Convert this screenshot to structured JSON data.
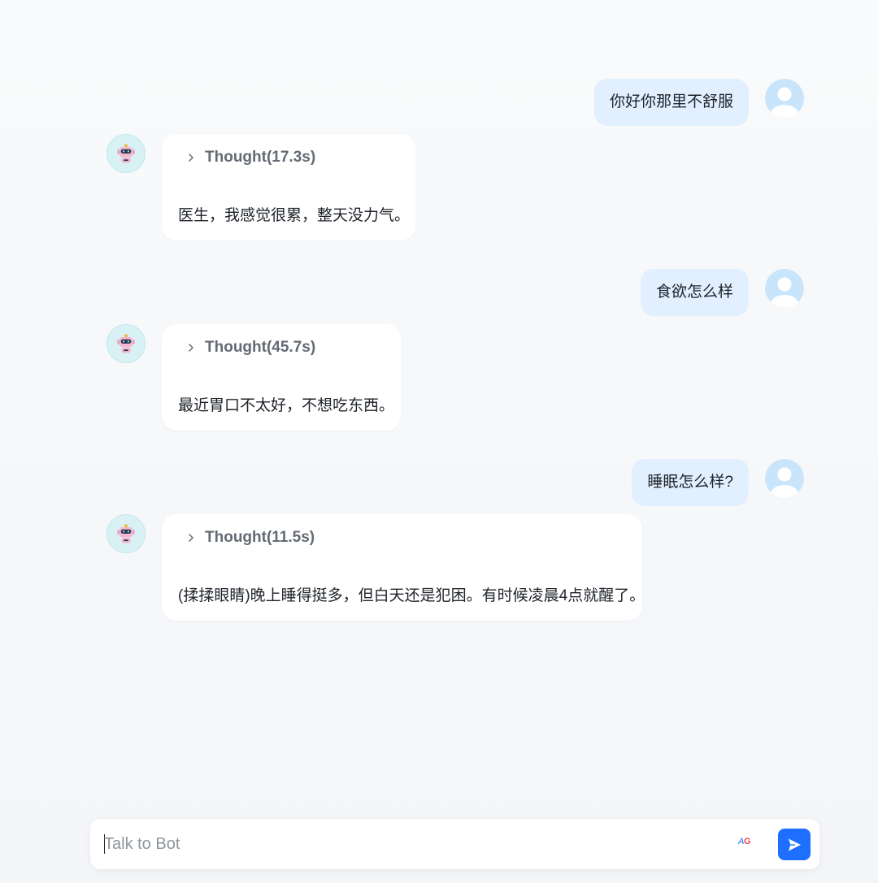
{
  "messages": [
    {
      "role": "user",
      "text": "你好你那里不舒服"
    },
    {
      "role": "bot",
      "thought": "Thought(17.3s)",
      "text": "医生，我感觉很累，整天没力气。"
    },
    {
      "role": "user",
      "text": "食欲怎么样"
    },
    {
      "role": "bot",
      "thought": "Thought(45.7s)",
      "text": "最近胃口不太好，不想吃东西。"
    },
    {
      "role": "user",
      "text": "睡眠怎么样?"
    },
    {
      "role": "bot",
      "thought": "Thought(11.5s)",
      "text": "(揉揉眼睛)晚上睡得挺多，但白天还是犯困。有时候凌晨4点就醒了。"
    }
  ],
  "input": {
    "placeholder": "Talk to Bot",
    "value": ""
  },
  "icons": {
    "user_avatar": "user-avatar-icon",
    "bot_avatar": "robot-icon",
    "thought_toggle": "chevron-right-icon",
    "translate": "translate-icon",
    "send": "send-icon"
  },
  "colors": {
    "user_bubble": "#e1efff",
    "accent": "#1e6fff",
    "bot_card": "#ffffff",
    "thought_label": "#646a73"
  }
}
